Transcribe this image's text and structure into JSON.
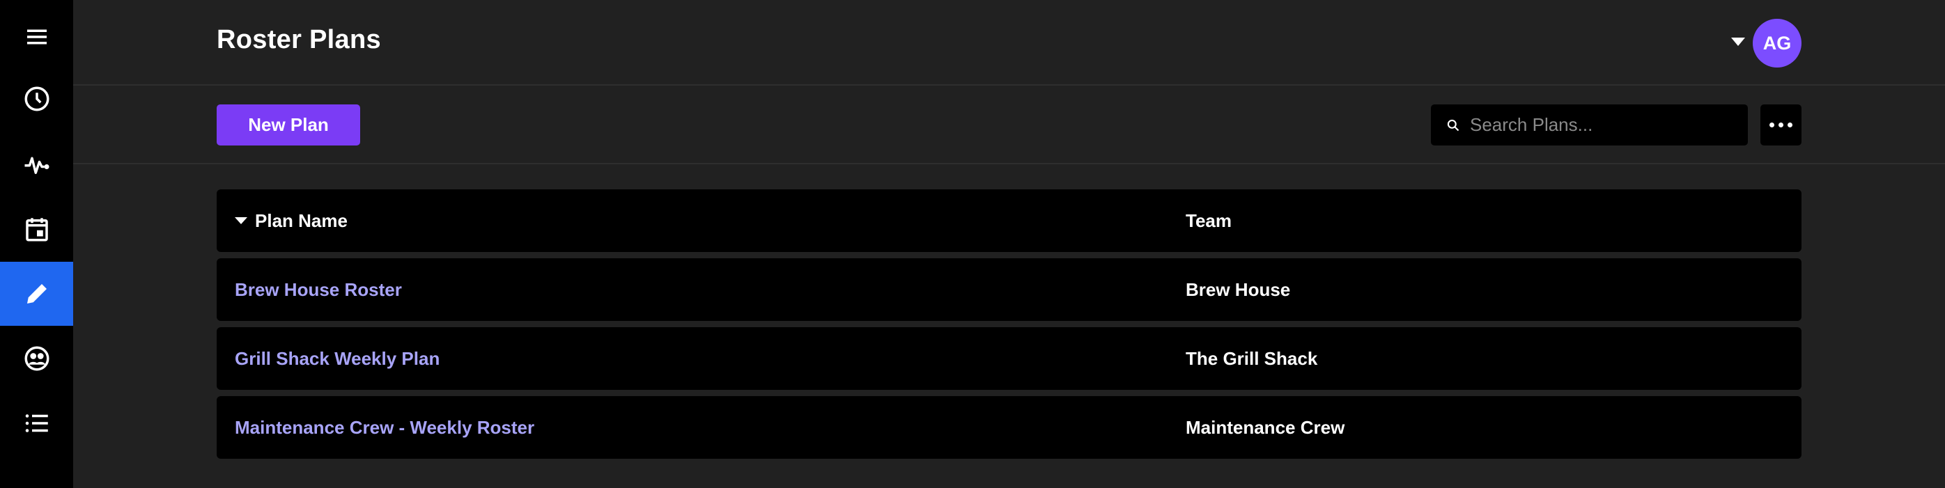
{
  "header": {
    "title": "Roster Plans",
    "user_initials": "AG"
  },
  "sidebar": {
    "items": [
      {
        "icon": "menu-icon"
      },
      {
        "icon": "clock-icon"
      },
      {
        "icon": "pulse-icon"
      },
      {
        "icon": "calendar-icon"
      },
      {
        "icon": "pencil-icon",
        "active": true
      },
      {
        "icon": "team-icon"
      },
      {
        "icon": "list-icon"
      }
    ]
  },
  "toolbar": {
    "new_label": "New Plan",
    "search_placeholder": "Search Plans..."
  },
  "table": {
    "columns": [
      "Plan Name",
      "Team"
    ],
    "rows": [
      {
        "name": "Brew House Roster",
        "team": "Brew House"
      },
      {
        "name": "Grill Shack Weekly Plan",
        "team": "The Grill Shack"
      },
      {
        "name": "Maintenance Crew - Weekly Roster",
        "team": "Maintenance Crew"
      }
    ]
  },
  "colors": {
    "accent": "#7b3cf5",
    "sidebar_active": "#1f67f0",
    "link": "#a8a4f8",
    "background": "#212121"
  }
}
